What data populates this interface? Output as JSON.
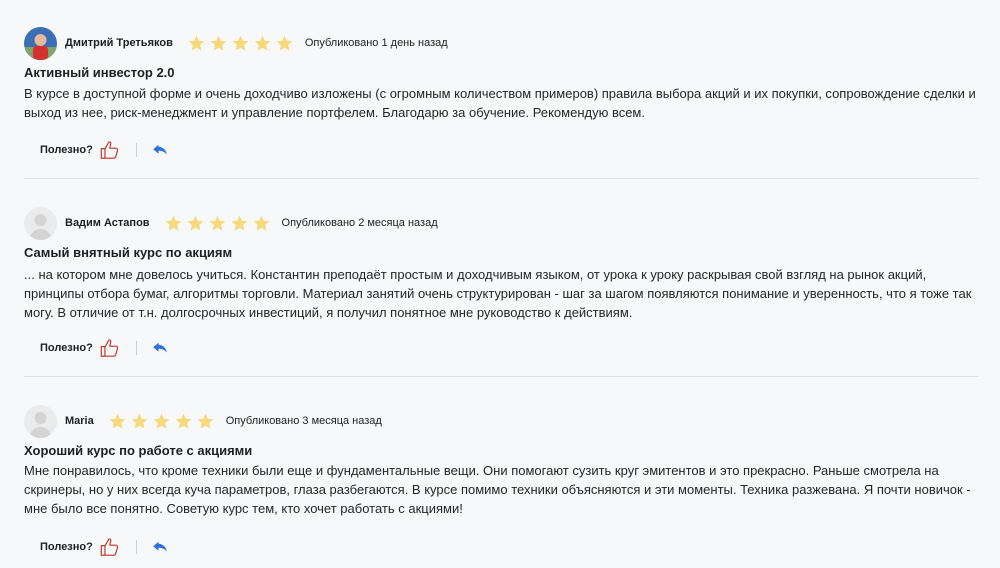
{
  "reviews": [
    {
      "author": "Дмитрий Третьяков",
      "rating": 5,
      "published": "Опубликовано 1 день назад",
      "title": "Активный инвестор 2.0",
      "text": "В курсе в доступной форме и очень доходчиво изложены (с огромным количеством примеров) правила выбора акций и их покупки, сопровождение сделки и выход из нее, риск-менеджмент и управление портфелем. Благодарю за обучение. Рекомендую всем.",
      "useful_label": "Полезно?",
      "has_photo": true
    },
    {
      "author": "Вадим Астапов",
      "rating": 5,
      "published": "Опубликовано 2 месяца назад",
      "title": "Самый внятный курс по акциям",
      "text": "... на котором мне довелось учиться. Константин преподаёт простым и доходчивым языком, от урока к уроку раскрывая свой взгляд на рынок акций, принципы отбора бумаг, алгоритмы торговли. Материал занятий очень структурирован - шаг за шагом появляются понимание и уверенность, что я тоже так могу. В отличие от т.н. долгосрочных инвестиций, я получил понятное мне руководство к действиям.",
      "useful_label": "Полезно?",
      "has_photo": false
    },
    {
      "author": "Maria",
      "rating": 5,
      "published": "Опубликовано 3 месяца назад",
      "title": "Хороший курс по работе с акциями",
      "text": "Мне понравилось, что кроме техники были еще и фундаментальные вещи. Они помогают сузить круг эмитентов и это прекрасно. Раньше смотрела на скринеры, но у них всегда куча параметров, глаза разбегаются. В курсе помимо техники объясняются и эти моменты. Техника разжевана. Я почти новичок - мне было все понятно. Советую курс тем, кто хочет работать с акциями!",
      "useful_label": "Полезно?",
      "has_photo": false
    }
  ],
  "colors": {
    "star": "#f5d97a",
    "like_icon": "#c0392b",
    "reply_icon": "#2f6fd6",
    "background": "#f7f8fa"
  },
  "icons": [
    "star-icon",
    "thumbs-up-icon",
    "reply-icon"
  ]
}
